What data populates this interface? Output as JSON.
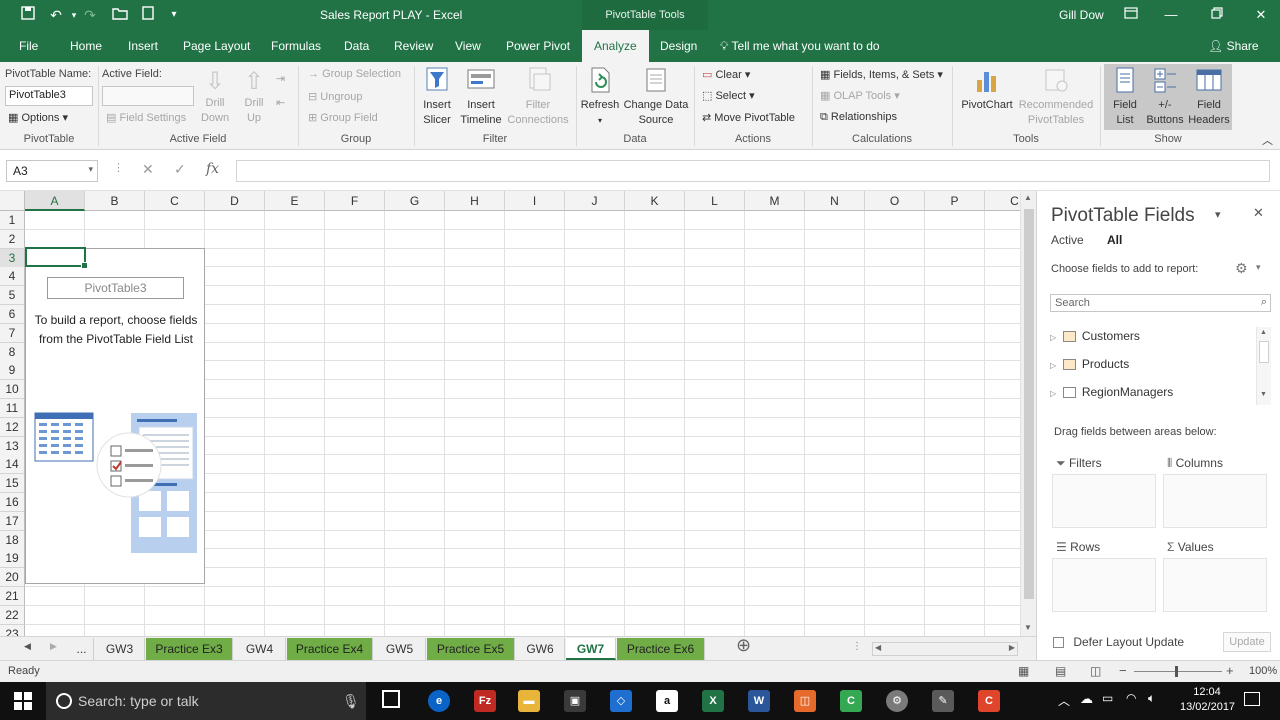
{
  "window": {
    "title": "Sales Report PLAY  -  Excel",
    "tools_context": "PivotTable Tools",
    "user": "Gill Dow"
  },
  "menu": {
    "tabs": [
      "File",
      "Home",
      "Insert",
      "Page Layout",
      "Formulas",
      "Data",
      "Review",
      "View",
      "Power Pivot",
      "Analyze",
      "Design"
    ],
    "active_tab": "Analyze",
    "tell_me": "Tell me what you want to do",
    "share": "Share"
  },
  "ribbon": {
    "pivottable_name_label": "PivotTable Name:",
    "pivottable_name_value": "PivotTable3",
    "options": "Options",
    "active_field_label": "Active Field:",
    "field_settings": "Field Settings",
    "drill_down": "Drill Down",
    "drill_up": "Drill Up",
    "group_selection": "Group Selection",
    "ungroup": "Ungroup",
    "group_field": "Group Field",
    "insert_slicer": "Insert Slicer",
    "insert_timeline": "Insert Timeline",
    "filter_connections": "Filter Connections",
    "refresh": "Refresh",
    "change_data_source": "Change Data Source",
    "clear": "Clear",
    "select": "Select",
    "move_pivottable": "Move PivotTable",
    "fields_items_sets": "Fields, Items, & Sets",
    "olap_tools": "OLAP Tools",
    "relationships": "Relationships",
    "pivotchart": "PivotChart",
    "recommended_pivottables": "Recommended PivotTables",
    "field_list": "Field List",
    "plus_minus_buttons": "+/- Buttons",
    "field_headers": "Field Headers",
    "groups": {
      "pivottable": "PivotTable",
      "active_field": "Active Field",
      "group": "Group",
      "filter": "Filter",
      "data": "Data",
      "actions": "Actions",
      "calculations": "Calculations",
      "tools": "Tools",
      "show": "Show"
    }
  },
  "formula_bar": {
    "name_box": "A3",
    "fx": "fx",
    "formula": ""
  },
  "grid": {
    "columns": [
      "A",
      "B",
      "C",
      "D",
      "E",
      "F",
      "G",
      "H",
      "I",
      "J",
      "K",
      "L",
      "M",
      "N",
      "O",
      "P",
      "C"
    ],
    "rows": [
      "1",
      "2",
      "3",
      "4",
      "5",
      "6",
      "7",
      "8",
      "9",
      "10",
      "11",
      "12",
      "13",
      "14",
      "15",
      "16",
      "17",
      "18",
      "19",
      "20",
      "21",
      "22",
      "23"
    ],
    "active_cell": "A3"
  },
  "pivot_placeholder": {
    "name": "PivotTable3",
    "text": "To build a report, choose fields from the PivotTable Field List"
  },
  "sheet_tabs": [
    {
      "label": "...",
      "style": "plain"
    },
    {
      "label": "GW3",
      "style": "plain"
    },
    {
      "label": "Practice Ex3",
      "style": "green"
    },
    {
      "label": "GW4",
      "style": "plain"
    },
    {
      "label": "Practice Ex4",
      "style": "green"
    },
    {
      "label": "GW5",
      "style": "plain"
    },
    {
      "label": "Practice Ex5",
      "style": "green"
    },
    {
      "label": "GW6",
      "style": "plain"
    },
    {
      "label": "GW7",
      "style": "active"
    },
    {
      "label": "Practice Ex6",
      "style": "green"
    }
  ],
  "field_pane": {
    "title": "PivotTable Fields",
    "tab_active": "Active",
    "tab_all": "All",
    "choose_text": "Choose fields to add to report:",
    "search_placeholder": "Search",
    "fields": [
      "Customers",
      "Products",
      "RegionManagers"
    ],
    "drag_text": "Drag fields between areas below:",
    "areas": {
      "filters": "Filters",
      "columns": "Columns",
      "rows": "Rows",
      "values": "Values"
    },
    "defer_label": "Defer Layout Update",
    "update_button": "Update"
  },
  "status": {
    "ready": "Ready",
    "zoom": "100%"
  },
  "taskbar": {
    "search_placeholder": "Search: type or talk",
    "time": "12:04",
    "date": "13/02/2017"
  },
  "colors": {
    "excel_green": "#217346",
    "tab_green": "#70ad47"
  }
}
